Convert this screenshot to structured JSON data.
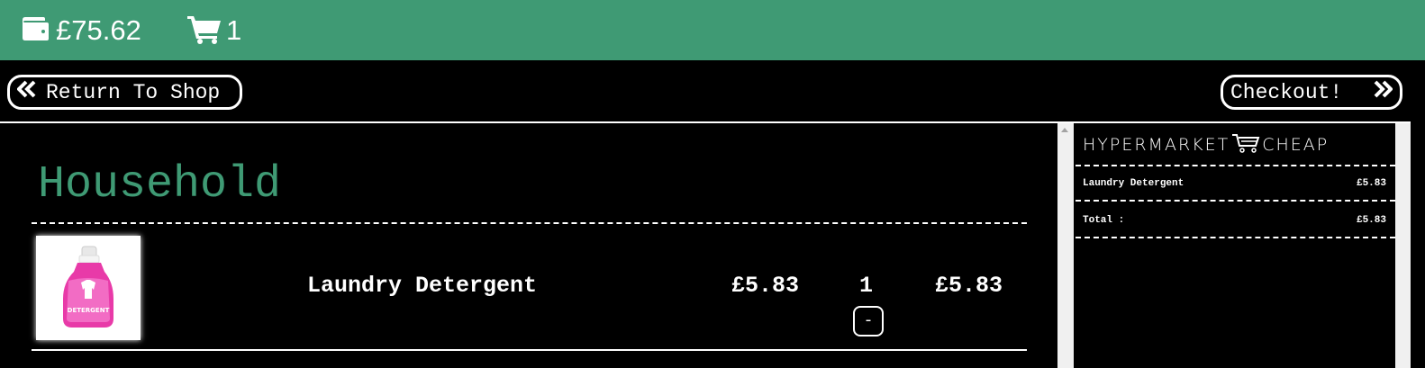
{
  "topbar": {
    "wallet_icon": "wallet-icon",
    "balance": "£75.62",
    "cart_icon": "shopping-cart-icon",
    "cart_count": "1",
    "color": "#3f9a74"
  },
  "nav": {
    "return_label": "Return To Shop",
    "return_icon": "double-chevron-left-icon",
    "checkout_label": "Checkout!",
    "checkout_icon": "double-chevron-right-icon"
  },
  "basket": {
    "category": "Household",
    "items": [
      {
        "name": "Laundry Detergent",
        "image_icon": "detergent-bottle-icon",
        "image_label": "DETERGENT",
        "unit_price": "£5.83",
        "quantity": "1",
        "line_total": "£5.83",
        "decrement_label": "-"
      }
    ]
  },
  "receipt": {
    "brand_left": "HYPERMARKET",
    "brand_right": "CHEAP",
    "lines": [
      {
        "label": "Laundry Detergent",
        "amount": "£5.83"
      }
    ],
    "total_label": "Total :",
    "total_amount": "£5.83"
  }
}
